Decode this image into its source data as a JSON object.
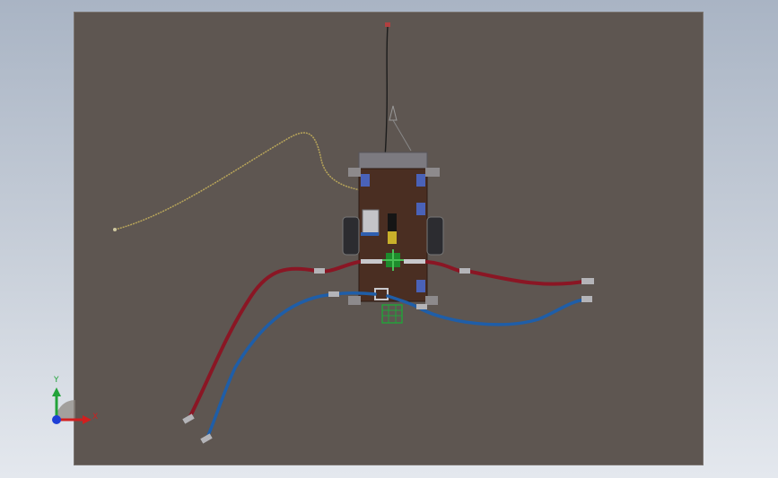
{
  "triad": {
    "x_label": "X",
    "y_label": "Y",
    "x_color": "#d11f1f",
    "y_color": "#22a33a",
    "z_color": "#1e3fd6"
  },
  "colors": {
    "viewport": "#5e5651",
    "chassis": "#4a2e22",
    "red_cable": "#8a1624",
    "blue_cable": "#1f5ea8",
    "yellow_wire": "#b8a55a",
    "black_wire": "#1c1c1c"
  }
}
